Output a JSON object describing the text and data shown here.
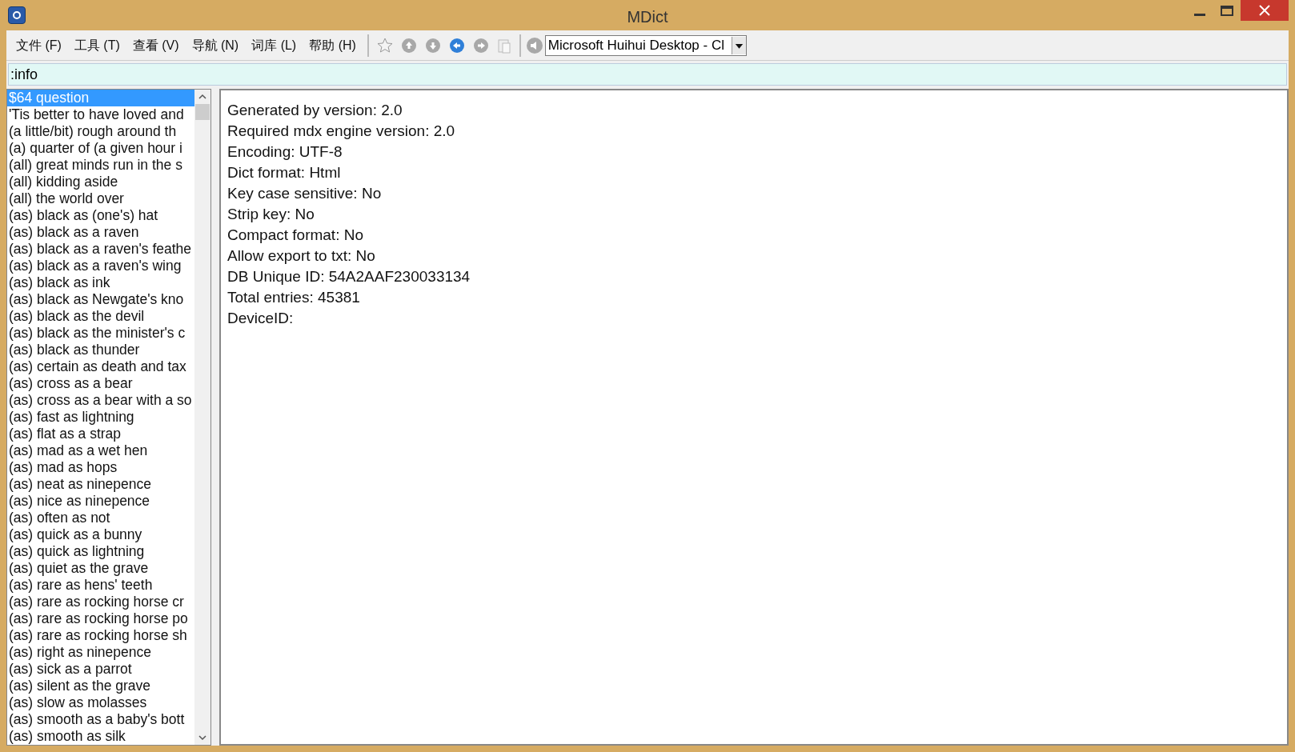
{
  "window": {
    "title": "MDict"
  },
  "menu": [
    "文件 (F)",
    "工具 (T)",
    "查看 (V)",
    "导航 (N)",
    "词库 (L)",
    "帮助 (H)"
  ],
  "voice_dropdown": {
    "value": "Microsoft Huihui Desktop - Cl"
  },
  "search": {
    "value": ":info"
  },
  "word_list": [
    {
      "text": "$64 question",
      "selected": true
    },
    {
      "text": "'Tis better to have loved and",
      "selected": false
    },
    {
      "text": "(a little/bit) rough around th",
      "selected": false
    },
    {
      "text": "(a) quarter of (a given hour i",
      "selected": false
    },
    {
      "text": "(all) great minds run in the s",
      "selected": false
    },
    {
      "text": "(all) kidding aside",
      "selected": false
    },
    {
      "text": "(all) the world over",
      "selected": false
    },
    {
      "text": "(as) black as (one's) hat",
      "selected": false
    },
    {
      "text": "(as) black as a raven",
      "selected": false
    },
    {
      "text": "(as) black as a raven's feathe",
      "selected": false
    },
    {
      "text": "(as) black as a raven's wing",
      "selected": false
    },
    {
      "text": "(as) black as ink",
      "selected": false
    },
    {
      "text": "(as) black as Newgate's kno",
      "selected": false
    },
    {
      "text": "(as) black as the devil",
      "selected": false
    },
    {
      "text": "(as) black as the minister's c",
      "selected": false
    },
    {
      "text": "(as) black as thunder",
      "selected": false
    },
    {
      "text": "(as) certain as death and tax",
      "selected": false
    },
    {
      "text": "(as) cross as a bear",
      "selected": false
    },
    {
      "text": "(as) cross as a bear with a so",
      "selected": false
    },
    {
      "text": "(as) fast as lightning",
      "selected": false
    },
    {
      "text": "(as) flat as a strap",
      "selected": false
    },
    {
      "text": "(as) mad as a wet hen",
      "selected": false
    },
    {
      "text": "(as) mad as hops",
      "selected": false
    },
    {
      "text": "(as) neat as ninepence",
      "selected": false
    },
    {
      "text": "(as) nice as ninepence",
      "selected": false
    },
    {
      "text": "(as) often as not",
      "selected": false
    },
    {
      "text": "(as) quick as a bunny",
      "selected": false
    },
    {
      "text": "(as) quick as lightning",
      "selected": false
    },
    {
      "text": "(as) quiet as the grave",
      "selected": false
    },
    {
      "text": "(as) rare as hens' teeth",
      "selected": false
    },
    {
      "text": "(as) rare as rocking horse cr",
      "selected": false
    },
    {
      "text": "(as) rare as rocking horse po",
      "selected": false
    },
    {
      "text": "(as) rare as rocking horse sh",
      "selected": false
    },
    {
      "text": "(as) right as ninepence",
      "selected": false
    },
    {
      "text": "(as) sick as a parrot",
      "selected": false
    },
    {
      "text": "(as) silent as the grave",
      "selected": false
    },
    {
      "text": "(as) slow as molasses",
      "selected": false
    },
    {
      "text": "(as) smooth as a baby's bott",
      "selected": false
    },
    {
      "text": "(as) smooth as silk",
      "selected": false
    }
  ],
  "info_lines": [
    "Generated by version: 2.0",
    "Required mdx engine version: 2.0",
    "Encoding: UTF-8",
    "Dict format: Html",
    "Key case sensitive: No",
    "Strip key: No",
    "Compact format: No",
    "Allow export to txt: No",
    "DB Unique ID: 54A2AAF230033134",
    "Total entries: 45381",
    "DeviceID:"
  ]
}
